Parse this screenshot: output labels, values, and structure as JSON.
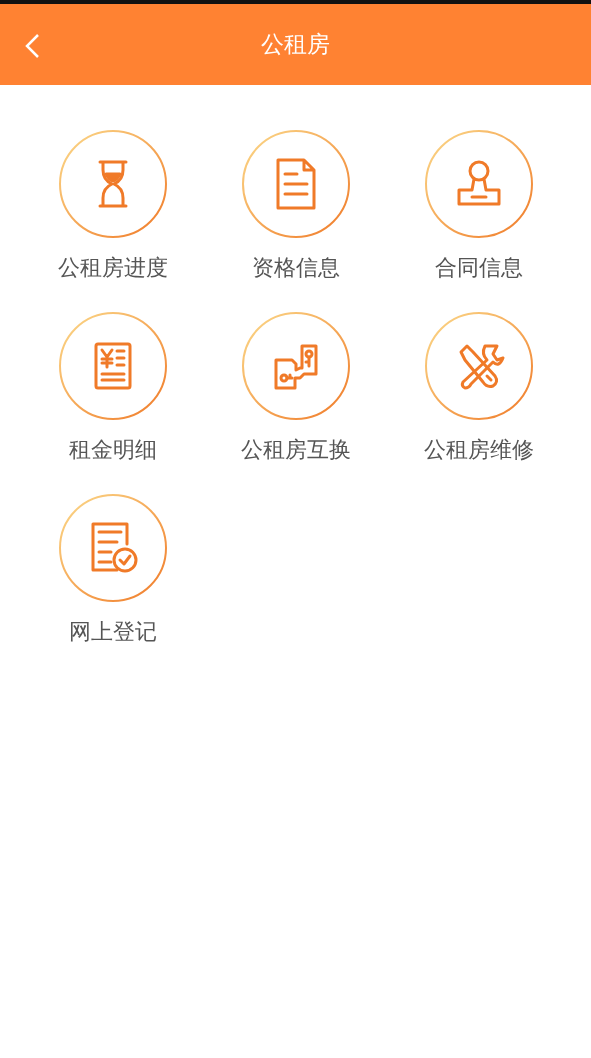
{
  "header": {
    "title": "公租房"
  },
  "tiles": [
    {
      "kind": "hourglass",
      "label": "公租房进度"
    },
    {
      "kind": "document",
      "label": "资格信息"
    },
    {
      "kind": "stamp",
      "label": "合同信息"
    },
    {
      "kind": "receipt",
      "label": "租金明细"
    },
    {
      "kind": "exchange",
      "label": "公租房互换"
    },
    {
      "kind": "tools",
      "label": "公租房维修"
    },
    {
      "kind": "register",
      "label": "网上登记"
    }
  ]
}
